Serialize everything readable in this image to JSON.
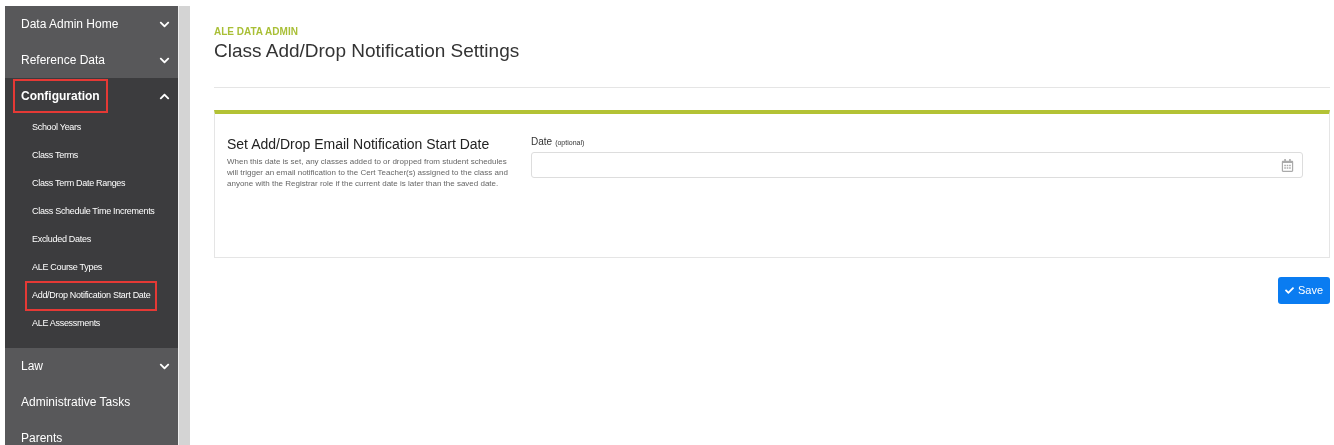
{
  "sidebar": {
    "items": [
      {
        "label": "Data Admin Home",
        "expanded": false,
        "highlighted": false
      },
      {
        "label": "Reference Data",
        "expanded": false,
        "highlighted": false
      },
      {
        "label": "Configuration",
        "expanded": true,
        "highlighted": true,
        "children": [
          {
            "label": "School Years",
            "highlighted": false
          },
          {
            "label": "Class Terms",
            "highlighted": false
          },
          {
            "label": "Class Term Date Ranges",
            "highlighted": false
          },
          {
            "label": "Class Schedule Time Increments",
            "highlighted": false
          },
          {
            "label": "Excluded Dates",
            "highlighted": false
          },
          {
            "label": "ALE Course Types",
            "highlighted": false
          },
          {
            "label": "Add/Drop Notification Start Date",
            "highlighted": true
          },
          {
            "label": "ALE Assessments",
            "highlighted": false
          }
        ]
      },
      {
        "label": "Law",
        "expanded": false,
        "highlighted": false
      },
      {
        "label": "Administrative Tasks",
        "highlighted": false
      },
      {
        "label": "Parents",
        "highlighted": false
      }
    ]
  },
  "header": {
    "eyebrow": "ALE DATA ADMIN",
    "title": "Class Add/Drop Notification Settings"
  },
  "card": {
    "heading": "Set Add/Drop Email Notification Start Date",
    "description": "When this date is set, any classes added to or dropped from student schedules will trigger an email notification to the Cert Teacher(s) assigned to the class and anyone with the Registrar role if the current date is later than the saved date.",
    "field": {
      "label": "Date",
      "hint": "(optional)"
    }
  },
  "save_button": "Save"
}
